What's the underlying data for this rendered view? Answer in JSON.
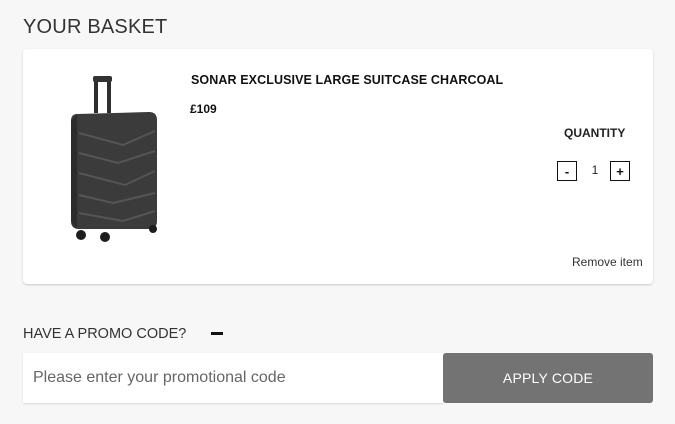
{
  "basket": {
    "title": "YOUR BASKET"
  },
  "item": {
    "name": "SONAR EXCLUSIVE LARGE SUITCASE CHARCOAL",
    "price": "£109",
    "image_icon": "suitcase-icon",
    "quantity_label": "QUANTITY",
    "quantity": "1",
    "decrement_label": "-",
    "increment_label": "+",
    "remove_label": "Remove item"
  },
  "promo": {
    "label": "HAVE A PROMO CODE?",
    "toggle_icon": "minus-icon",
    "placeholder": "Please enter your promotional code",
    "value": "",
    "apply_label": "APPLY CODE"
  },
  "colors": {
    "background": "#f7f7f7",
    "card": "#ffffff",
    "apply_button": "#737373",
    "suitcase": "#3a3a3a"
  }
}
